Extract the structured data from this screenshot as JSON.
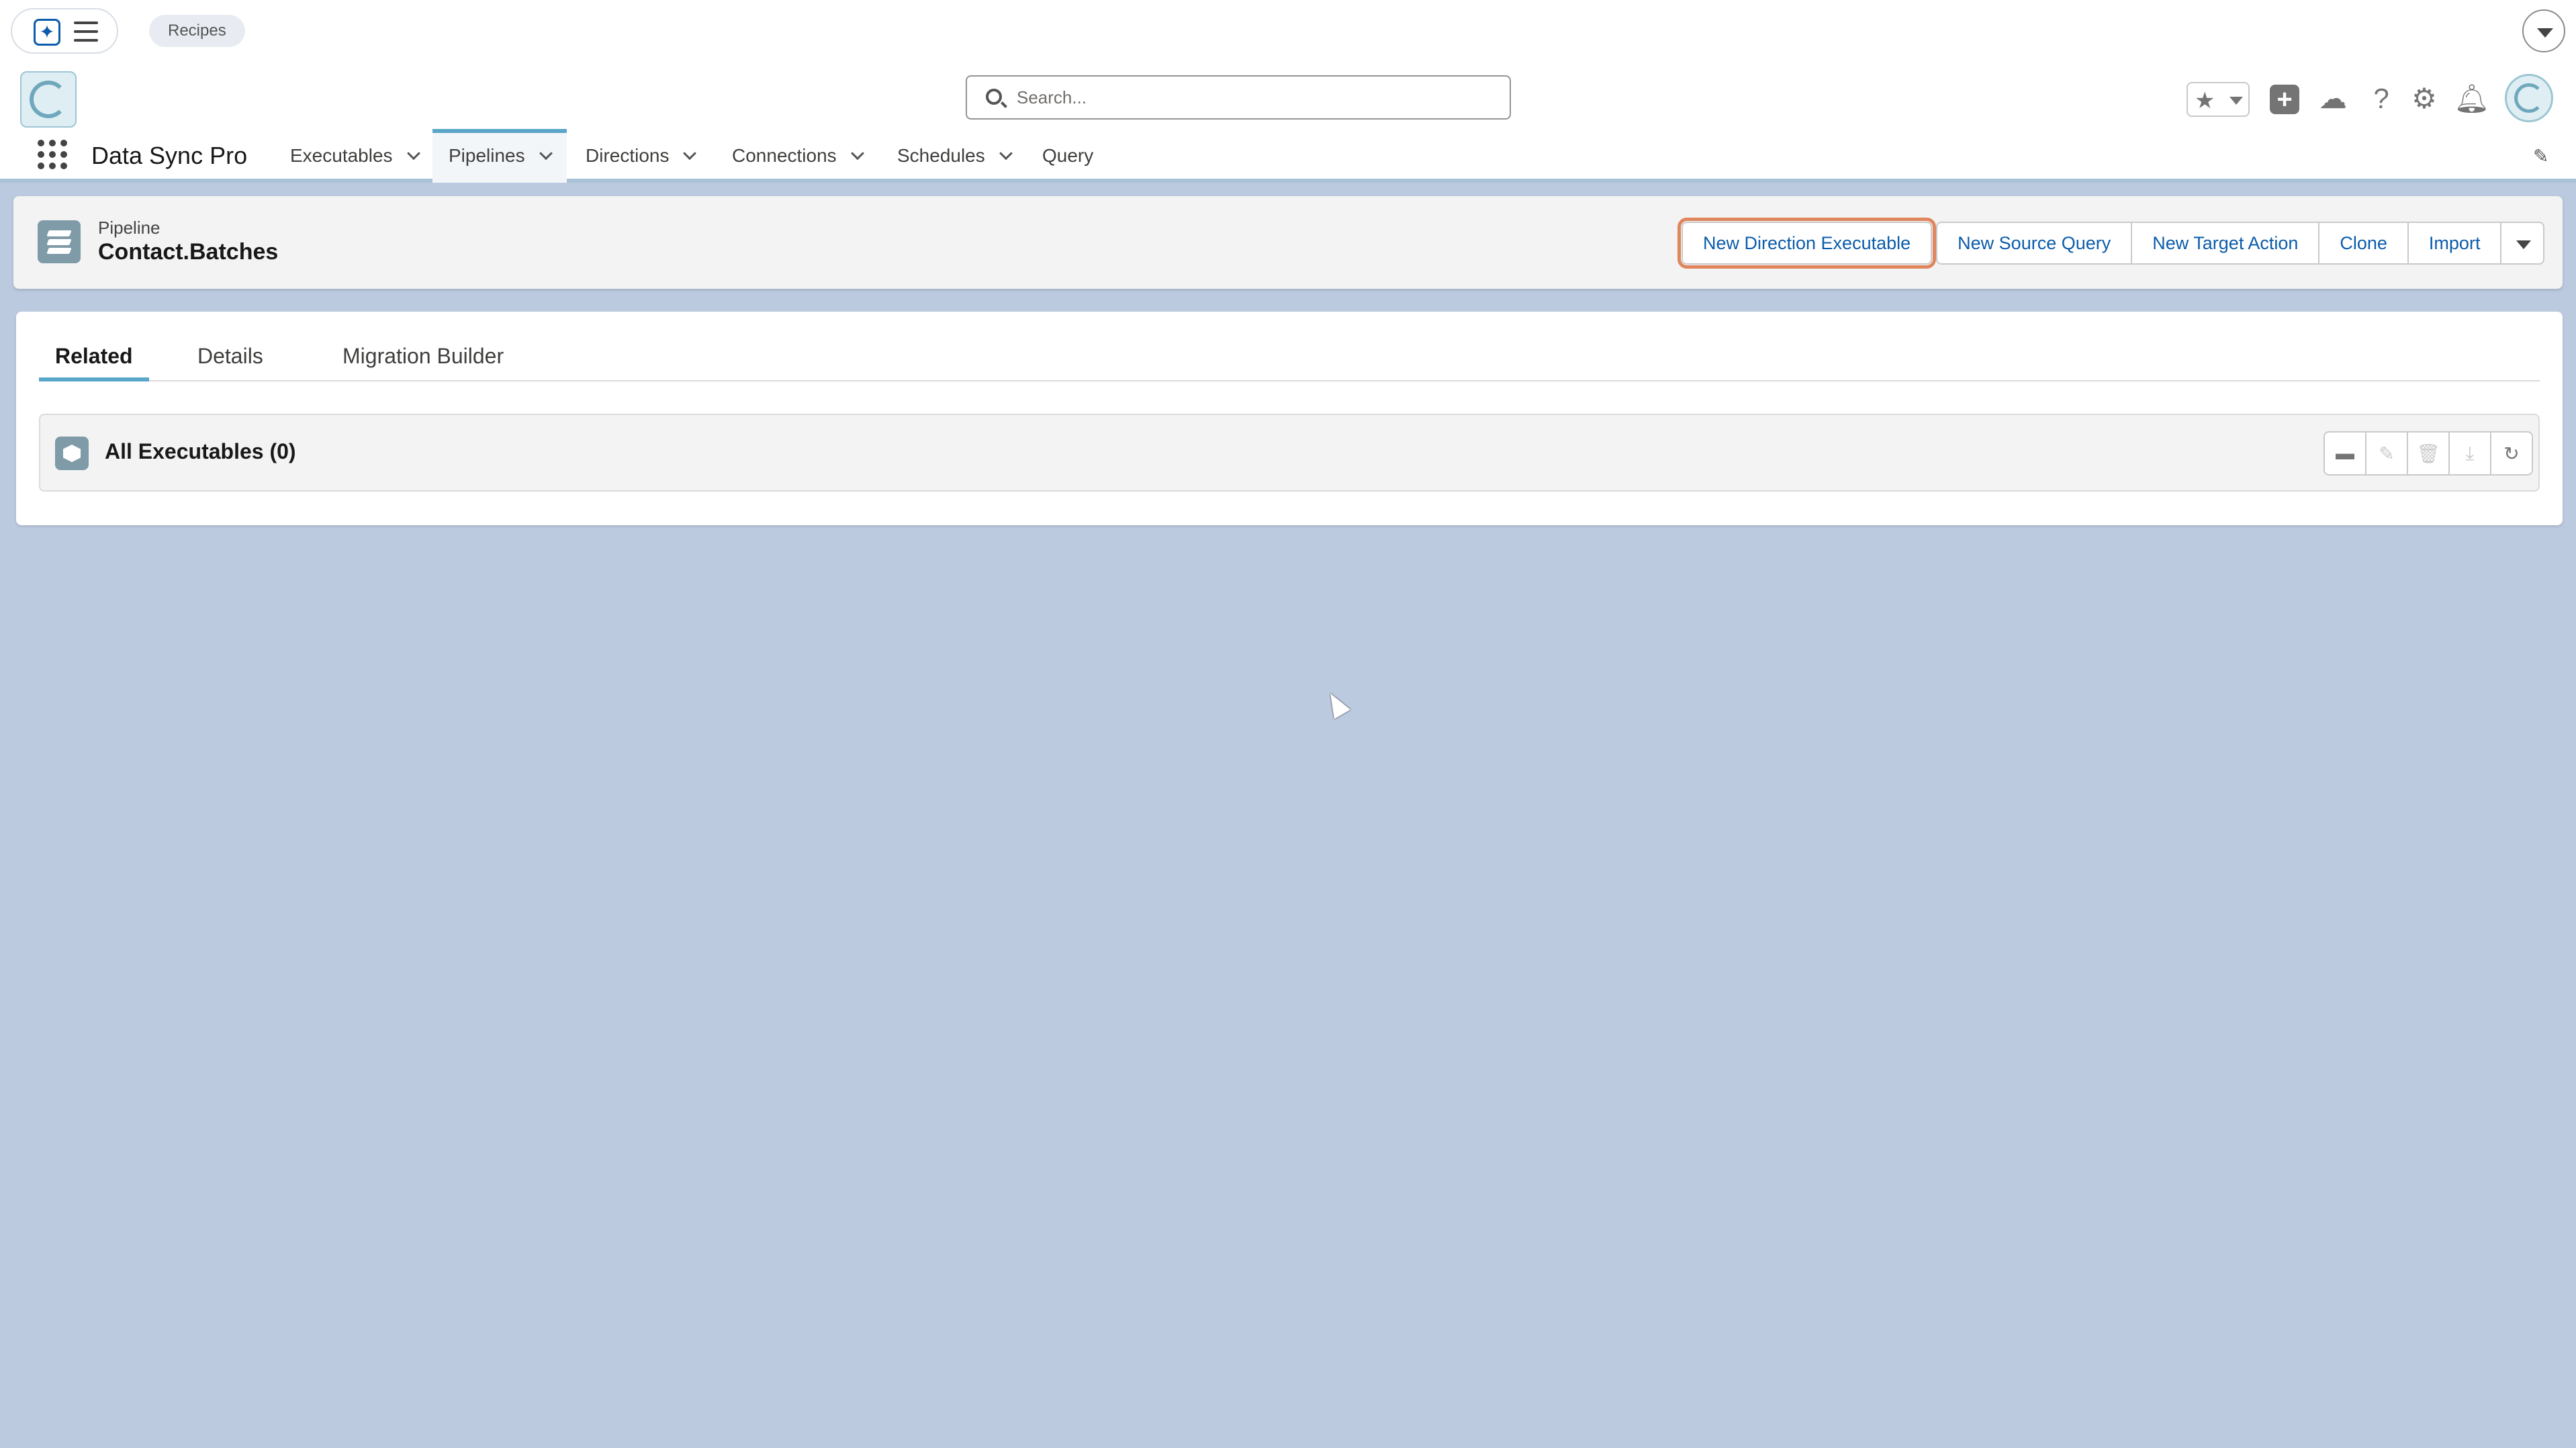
{
  "utility_bar": {
    "recipes_label": "Recipes"
  },
  "header": {
    "search_placeholder": "Search..."
  },
  "nav": {
    "app_name": "Data Sync Pro",
    "items": [
      {
        "label": "Executables",
        "has_menu": true
      },
      {
        "label": "Pipelines",
        "has_menu": true,
        "active": true
      },
      {
        "label": "Directions",
        "has_menu": true
      },
      {
        "label": "Connections",
        "has_menu": true
      },
      {
        "label": "Schedules",
        "has_menu": true
      },
      {
        "label": "Query",
        "has_menu": false
      }
    ]
  },
  "record": {
    "object_type": "Pipeline",
    "title": "Contact.Batches",
    "actions": {
      "new_direction_executable": "New Direction Executable",
      "new_source_query": "New Source Query",
      "new_target_action": "New Target Action",
      "clone": "Clone",
      "import": "Import"
    }
  },
  "tabs": {
    "related": "Related",
    "details": "Details",
    "migration_builder": "Migration Builder"
  },
  "related_list": {
    "title": "All Executables (0)"
  },
  "colors": {
    "page_background": "#bccadf",
    "accent": "#5aa6c8",
    "link_blue": "#0b5cab",
    "highlight_outline": "#e0855c",
    "record_icon": "#7f9ba8"
  }
}
